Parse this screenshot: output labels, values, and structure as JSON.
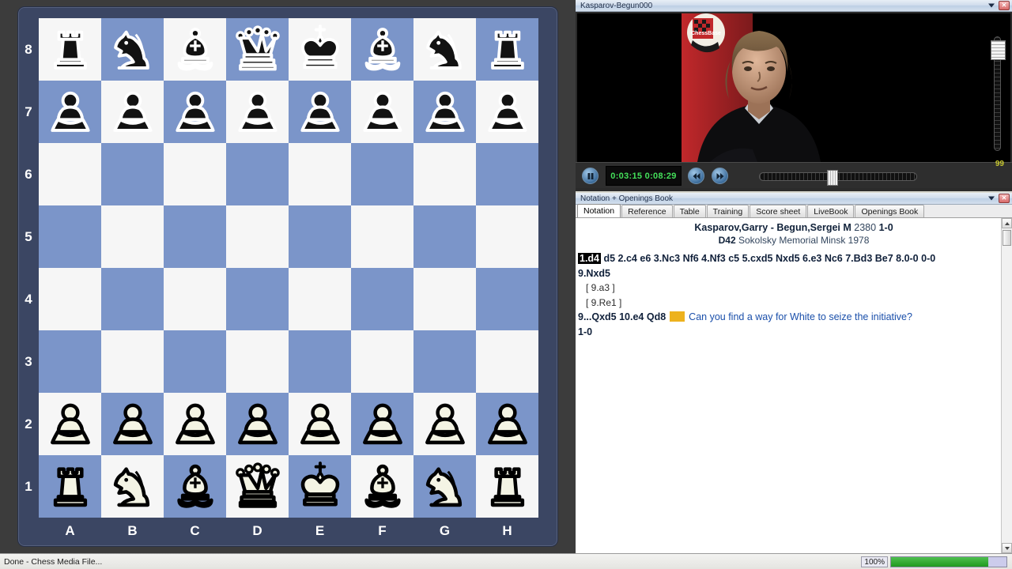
{
  "video_window": {
    "title": "Kasparov-Begun000",
    "chevron_icon": "chevron-down-icon",
    "close_icon": "close-icon",
    "banner_text": "ChessBase",
    "controls": {
      "pause_icon": "pause-icon",
      "prev_icon": "rewind-icon",
      "next_icon": "fast-forward-icon",
      "elapsed": "0:03:15",
      "duration": "0:08:29",
      "time_display": "0:03:15  0:08:29",
      "scrub_label": "video-progress-slider",
      "volume_value": "99"
    }
  },
  "notation_window": {
    "title": "Notation + Openings Book",
    "chevron_icon": "chevron-down-icon",
    "close_icon": "close-icon",
    "tabs": [
      {
        "label": "Notation",
        "active": true
      },
      {
        "label": "Reference",
        "active": false
      },
      {
        "label": "Table",
        "active": false
      },
      {
        "label": "Training",
        "active": false
      },
      {
        "label": "Score sheet",
        "active": false
      },
      {
        "label": "LiveBook",
        "active": false
      },
      {
        "label": "Openings Book",
        "active": false
      }
    ],
    "game_header": {
      "white": "Kasparov,Garry",
      "dash": " - ",
      "black": "Begun,Sergei M",
      "black_elo": "2380",
      "result": "1-0",
      "eco": "D42",
      "event": "Sokolsky Memorial Minsk 1978"
    },
    "moves": {
      "selected_move": "1.d4",
      "main_line": "d5 2.c4 e6 3.Nc3 Nf6 4.Nf3 c5 5.cxd5 Nxd5 6.e3 Nc6 7.Bd3 Be7 8.0-0 0-0",
      "line2": "9.Nxd5",
      "variations": [
        "[ 9.a3 ]",
        "[ 9.Re1 ]"
      ],
      "continuation": "9...Qxd5  10.e4  Qd8",
      "annotation_color": "#edb21e",
      "annotation_text": "Can you find a way for White to seize the initiative?",
      "result_line": "1-0"
    }
  },
  "board": {
    "ranks": [
      "8",
      "7",
      "6",
      "5",
      "4",
      "3",
      "2",
      "1"
    ],
    "files": [
      "A",
      "B",
      "C",
      "D",
      "E",
      "F",
      "G",
      "H"
    ],
    "light_square_color": "#f6f6f6",
    "dark_square_color": "#7b95c9",
    "frame_color": "#3b4663",
    "position": [
      [
        "bR",
        "bN",
        "bB",
        "bQ",
        "bK",
        "bB",
        "bN",
        "bR"
      ],
      [
        "bP",
        "bP",
        "bP",
        "bP",
        "bP",
        "bP",
        "bP",
        "bP"
      ],
      [
        "",
        "",
        "",
        "",
        "",
        "",
        "",
        ""
      ],
      [
        "",
        "",
        "",
        "",
        "",
        "",
        "",
        ""
      ],
      [
        "",
        "",
        "",
        "",
        "",
        "",
        "",
        ""
      ],
      [
        "",
        "",
        "",
        "",
        "",
        "",
        "",
        ""
      ],
      [
        "wP",
        "wP",
        "wP",
        "wP",
        "wP",
        "wP",
        "wP",
        "wP"
      ],
      [
        "wR",
        "wN",
        "wB",
        "wQ",
        "wK",
        "wB",
        "wN",
        "wR"
      ]
    ]
  },
  "statusbar": {
    "text": "Done - Chess Media File...",
    "progress_percent": "100%",
    "progress_value": 100
  }
}
